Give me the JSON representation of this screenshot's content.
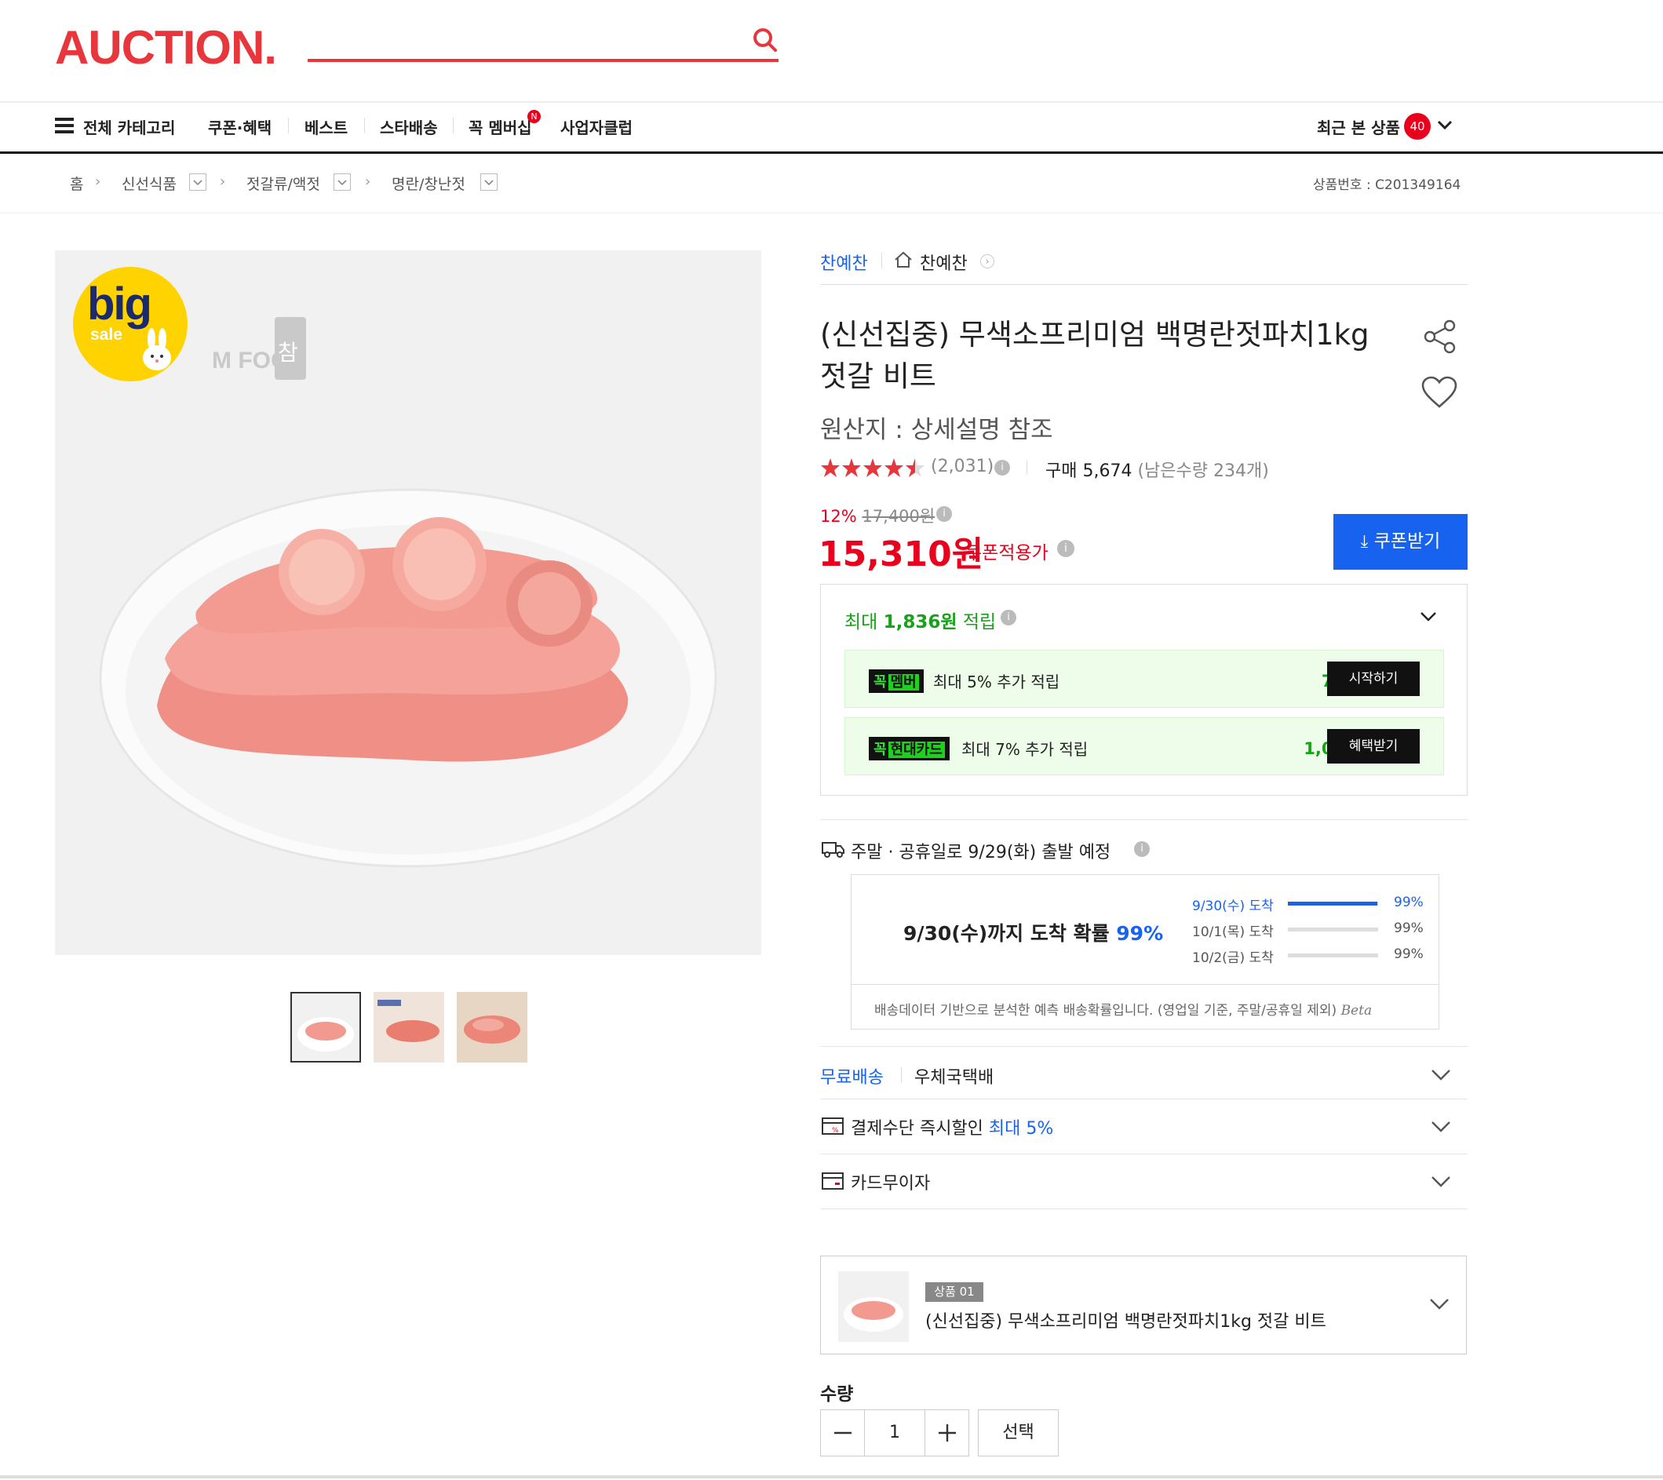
{
  "header": {
    "logo": "AUCTION.",
    "search_icon": "search-icon"
  },
  "nav": {
    "all_categories": "전체 카테고리",
    "items": [
      "쿠폰·혜택",
      "베스트",
      "스타배송",
      "꼭 멤버십",
      "사업자클럽"
    ],
    "membership_badge": "N",
    "recent_label": "최근 본 상품",
    "recent_count": "40"
  },
  "breadcrumb": {
    "home": "홈",
    "items": [
      "신선식품",
      "젓갈류/액젓",
      "명란/창난젓"
    ],
    "product_no_label": "상품번호 : ",
    "product_no": "C201349164"
  },
  "image": {
    "badge_big": "big",
    "badge_sale": "sale",
    "watermark": "M FOOD",
    "watermark_char": "참",
    "thumbnail_count": 3,
    "selected_thumbnail": 1
  },
  "seller": {
    "brand": "찬예찬",
    "shop": "찬예찬"
  },
  "product": {
    "title_line1": "(신선집중) 무색소프리미엄 백명란젓파치1kg",
    "title_line2": "젓갈 비트",
    "origin": "원산지 : 상세설명 참조",
    "rating": 4.5,
    "review_count": "(2,031)",
    "purchase_label": "구매 5,674",
    "remaining": "(남은수량 234개)",
    "discount_rate": "12%",
    "original_price": "17,400원",
    "price": "15,310원",
    "price_label": "쿠폰적용가",
    "coupon_button": "쿠폰받기"
  },
  "rewards": {
    "max_prefix": "최대 ",
    "max_amount": "1,836원",
    "max_suffix": " 적립",
    "rows": [
      {
        "tag_a": "꼭",
        "tag_b": "멤버",
        "text": "최대 5% 추가 적립",
        "amount": "765원",
        "button": "시작하기"
      },
      {
        "tag_a": "꼭",
        "tag_b": "현대카드",
        "text": "최대 7% 추가 적립",
        "amount": "1,071원",
        "button": "혜택받기"
      }
    ]
  },
  "delivery": {
    "dispatch": "주말 · 공휴일로 9/29(화) 출발 예정",
    "arrival_text": "9/30(수)까지 도착 확률 ",
    "arrival_pct": "99%",
    "rows": [
      {
        "date": "9/30(수) 도착",
        "pct": "99%",
        "fill": 0.99,
        "highlight": true
      },
      {
        "date": "10/1(목) 도착",
        "pct": "99%",
        "fill": 0,
        "highlight": false
      },
      {
        "date": "10/2(금) 도착",
        "pct": "99%",
        "fill": 0,
        "highlight": false
      }
    ],
    "note": "배송데이터 기반으로 분석한 예측 배송확률입니다. (영업일 기준, 주말/공휴일 제외)",
    "beta": "Beta"
  },
  "options": {
    "free_shipping": "무료배송",
    "courier": "우체국택배",
    "payment_label": "결제수단 즉시할인 ",
    "payment_highlight": "최대 5%",
    "card_label": "카드무이자"
  },
  "selected_product": {
    "badge": "상품 01",
    "name": "(신선집중) 무색소프리미엄 백명란젓파치1kg 젓갈 비트"
  },
  "quantity": {
    "label": "수량",
    "value": "1",
    "select_button": "선택"
  }
}
